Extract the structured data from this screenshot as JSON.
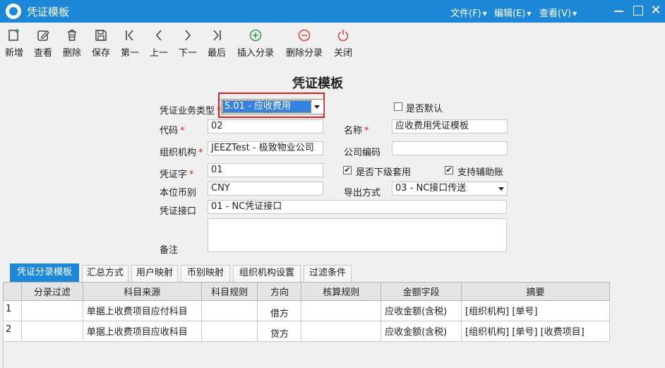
{
  "window": {
    "title": "凭证模板",
    "menus": [
      {
        "label": "文件(F)"
      },
      {
        "label": "编辑(E)"
      },
      {
        "label": "查看(V)"
      }
    ]
  },
  "toolbar": {
    "buttons": [
      {
        "label": "新增",
        "icon": "new-doc-icon"
      },
      {
        "label": "查看",
        "icon": "edit-icon"
      },
      {
        "label": "删除",
        "icon": "trash-icon"
      },
      {
        "label": "保存",
        "icon": "save-icon"
      },
      {
        "label": "第一",
        "icon": "first-icon"
      },
      {
        "label": "上一",
        "icon": "prev-icon"
      },
      {
        "label": "下一",
        "icon": "next-icon"
      },
      {
        "label": "最后",
        "icon": "last-icon"
      },
      {
        "label": "插入分录",
        "icon": "plus-circle-icon"
      },
      {
        "label": "删除分录",
        "icon": "minus-circle-icon"
      },
      {
        "label": "关闭",
        "icon": "power-icon"
      }
    ]
  },
  "form": {
    "title": "凭证模板",
    "voucher_type_label": "凭证业务类型",
    "voucher_type_value": "5.01 - 应收费用",
    "is_default_label": "是否默认",
    "is_default_checked": false,
    "code_label": "代码",
    "code_value": "02",
    "name_label": "名称",
    "name_value": "应收费用凭证模板",
    "org_label": "组织机构",
    "org_value": "JEEZTest  - 极致物业公司",
    "company_code_label": "公司编码",
    "company_code_value": "",
    "voucher_word_label": "凭证字",
    "voucher_word_value": "01",
    "sub_apply_label": "是否下级套用",
    "sub_apply_checked": true,
    "aux_account_label": "支持辅助账",
    "aux_account_checked": true,
    "currency_label": "本位币别",
    "currency_value": "CNY",
    "export_label": "导出方式",
    "export_value": "03 - NC接口传送",
    "interface_label": "凭证接口",
    "interface_value": "01 - NC凭证接口",
    "remark_label": "备注",
    "remark_value": "",
    "required_mark": "*",
    "check_mark": "✔"
  },
  "tabs": [
    {
      "label": "凭证分录模板",
      "active": true
    },
    {
      "label": "汇总方式"
    },
    {
      "label": "用户映射"
    },
    {
      "label": "币别映射"
    },
    {
      "label": "组织机构设置"
    },
    {
      "label": "过滤条件"
    }
  ],
  "grid": {
    "columns": [
      "分录过滤",
      "科目来源",
      "科目规则",
      "方向",
      "核算规则",
      "金额字段",
      "摘要"
    ],
    "rows": [
      {
        "index": "1",
        "filter": "",
        "source": "单据上收费项目应付科目",
        "rule": "",
        "direction": "借方",
        "calc_rule": "",
        "amount": "应收金额(含税)",
        "summary": "[组织机构] [单号]"
      },
      {
        "index": "2",
        "filter": "",
        "source": "单据上收费项目应收科目",
        "rule": "",
        "direction": "贷方",
        "calc_rule": "",
        "amount": "应收金额(含税)",
        "summary": "[组织机构] [单号] [收费项目]"
      }
    ]
  },
  "colors": {
    "titlebar": "#1e88d8",
    "highlight_border": "#e02020",
    "selection": "#3483e0"
  }
}
